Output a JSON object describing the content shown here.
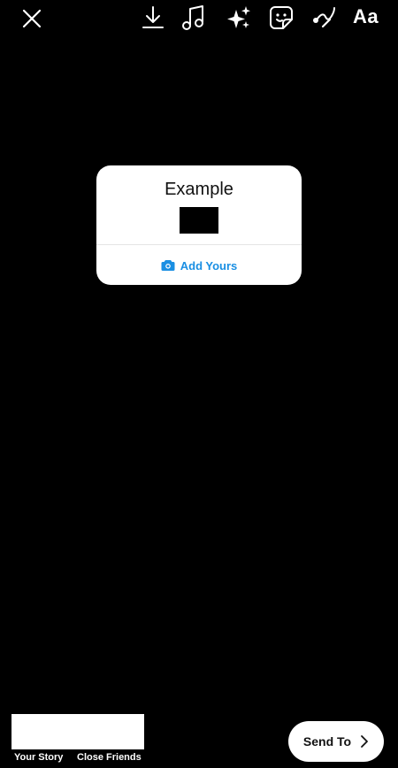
{
  "toolbar": {
    "text_tool_label": "Aa",
    "icons": [
      "close-icon",
      "download-icon",
      "music-icon",
      "effects-sparkle-icon",
      "sticker-icon",
      "draw-icon"
    ]
  },
  "sticker": {
    "title": "Example",
    "action_label": "Add Yours",
    "action_icon": "camera-icon",
    "accent_color": "#1a8fe3"
  },
  "bottom": {
    "your_story_label": "Your Story",
    "close_friends_label": "Close Friends",
    "send_label": "Send To",
    "send_icon": "chevron-right-icon"
  }
}
